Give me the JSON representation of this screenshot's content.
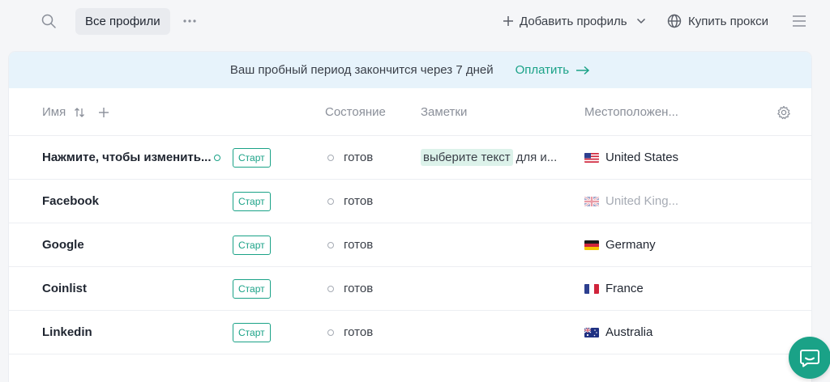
{
  "toolbar": {
    "profiles_tab": "Все профили",
    "add_profile": "Добавить профиль",
    "buy_proxy": "Купить прокси"
  },
  "banner": {
    "text": "Ваш пробный период закончится через 7 дней",
    "pay": "Оплатить"
  },
  "table": {
    "headers": {
      "name": "Имя",
      "state": "Состояние",
      "notes": "Заметки",
      "location": "Местоположен..."
    },
    "rows": [
      {
        "name": "Нажмите, чтобы изменить...",
        "start": "Старт",
        "state": "готов",
        "note_highlight": "выберите текст",
        "note_rest": "для и...",
        "location": "United States",
        "flag": "us"
      },
      {
        "name": "Facebook",
        "start": "Старт",
        "state": "готов",
        "note_highlight": "",
        "note_rest": "",
        "location": "United King...",
        "flag": "uk"
      },
      {
        "name": "Google",
        "start": "Старт",
        "state": "готов",
        "note_highlight": "",
        "note_rest": "",
        "location": "Germany",
        "flag": "de"
      },
      {
        "name": "Coinlist",
        "start": "Старт",
        "state": "готов",
        "note_highlight": "",
        "note_rest": "",
        "location": "France",
        "flag": "fr"
      },
      {
        "name": "Linkedin",
        "start": "Старт",
        "state": "готов",
        "note_highlight": "",
        "note_rest": "",
        "location": "Australia",
        "flag": "au"
      }
    ]
  },
  "colors": {
    "accent": "#1aa287",
    "banner_bg": "#e7f3fb",
    "note_highlight_bg": "#dcf2ea"
  },
  "icons": [
    "search-icon",
    "more-icon",
    "plus-icon",
    "chevron-down-icon",
    "globe-icon",
    "menu-icon",
    "sort-icon",
    "gear-icon",
    "arrow-right-icon",
    "chat-icon"
  ]
}
